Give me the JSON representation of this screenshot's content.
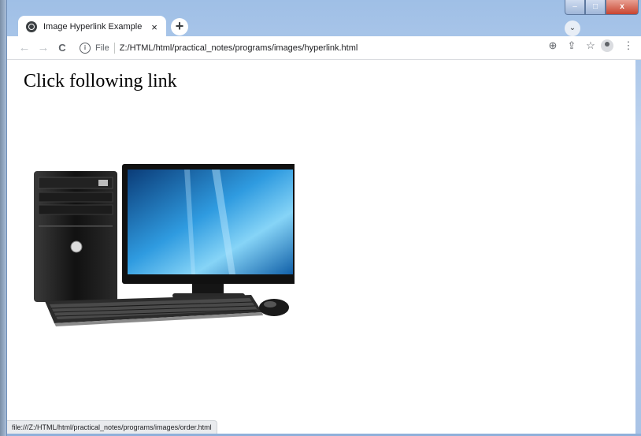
{
  "browser": {
    "tab": {
      "title": "Image Hyperlink Example",
      "close": "×"
    },
    "new_tab": "+",
    "window_controls": {
      "minimize": "–",
      "maximize": "□",
      "close": "x"
    },
    "nav": {
      "back": "←",
      "forward": "→",
      "reload": "C"
    },
    "address": {
      "scheme": "File",
      "url": "Z:/HTML/html/practical_notes/programs/images/hyperlink.html"
    },
    "toolbar_icons": [
      "zoom-icon",
      "share-icon",
      "star-icon",
      "profile-icon",
      "menu-icon"
    ]
  },
  "page": {
    "heading": "Click following link",
    "image": {
      "semantic": "desktop-computer-image"
    }
  },
  "statusbar": {
    "link_url": "file:///Z:/HTML/html/practical_notes/programs/images/order.html"
  }
}
